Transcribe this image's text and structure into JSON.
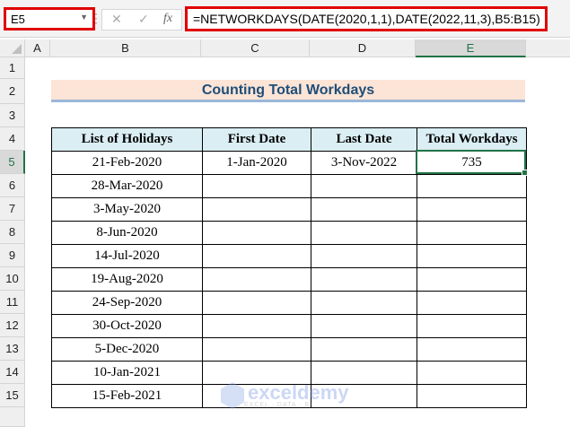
{
  "name_box": "E5",
  "formula_icons": [
    "cancel-icon",
    "enter-icon",
    "fx-icon"
  ],
  "formula": "=NETWORKDAYS(DATE(2020,1,1),DATE(2022,11,3),B5:B15)",
  "columns": [
    "A",
    "B",
    "C",
    "D",
    "E"
  ],
  "rows": [
    "1",
    "2",
    "3",
    "4",
    "5",
    "6",
    "7",
    "8",
    "9",
    "10",
    "11",
    "12",
    "13",
    "14",
    "15"
  ],
  "title": "Counting Total Workdays",
  "table": {
    "headers": [
      "List of Holidays",
      "First Date",
      "Last Date",
      "Total Workdays"
    ],
    "holidays": [
      "21-Feb-2020",
      "28-Mar-2020",
      "3-May-2020",
      "8-Jun-2020",
      "14-Jul-2020",
      "19-Aug-2020",
      "24-Sep-2020",
      "30-Oct-2020",
      "5-Dec-2020",
      "10-Jan-2021",
      "15-Feb-2021"
    ],
    "first_date": "1-Jan-2020",
    "last_date": "3-Nov-2022",
    "total_workdays": "735"
  },
  "watermark": {
    "brand": "exceldemy",
    "tagline": "EXCEL · DATA · BI"
  }
}
